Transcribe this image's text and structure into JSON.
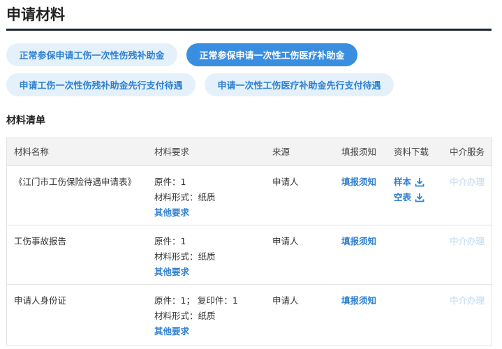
{
  "page": {
    "title": "申请材料"
  },
  "tabs": [
    {
      "label": "正常参保申请工伤一次性伤残补助金",
      "active": false
    },
    {
      "label": "正常参保申请一次性工伤医疗补助金",
      "active": true
    },
    {
      "label": "申请工伤一次性伤残补助金先行支付待遇",
      "active": false
    },
    {
      "label": "申请一次性工伤医疗补助金先行支付待遇",
      "active": false
    }
  ],
  "section": {
    "title": "材料清单"
  },
  "table": {
    "headers": [
      "材料名称",
      "材料要求",
      "来源",
      "填报须知",
      "资料下载",
      "中介服务"
    ],
    "rows": [
      {
        "name": "《江门市工伤保险待遇申请表》",
        "req_line1": "原件：1",
        "req_line2": "材料形式：纸质",
        "req_more": "其他要求",
        "source": "申请人",
        "notice": "填报须知",
        "download_sample": "样本",
        "download_blank": "空表",
        "agency": "中介办理"
      },
      {
        "name": "工伤事故报告",
        "req_line1": "原件：1",
        "req_line2": "材料形式：纸质",
        "req_more": "其他要求",
        "source": "申请人",
        "notice": "填报须知",
        "agency": "中介办理"
      },
      {
        "name": "申请人身份证",
        "req_line1": "原件：1； 复印件：1",
        "req_line2": "材料形式：纸质",
        "req_more": "其他要求",
        "source": "申请人",
        "notice": "填报须知",
        "agency": "中介办理"
      }
    ]
  },
  "colors": {
    "accent": "#3a8ee0",
    "link": "#2f80d1",
    "pill_bg": "#e4f1fb",
    "disabled": "#cfe3f5"
  }
}
